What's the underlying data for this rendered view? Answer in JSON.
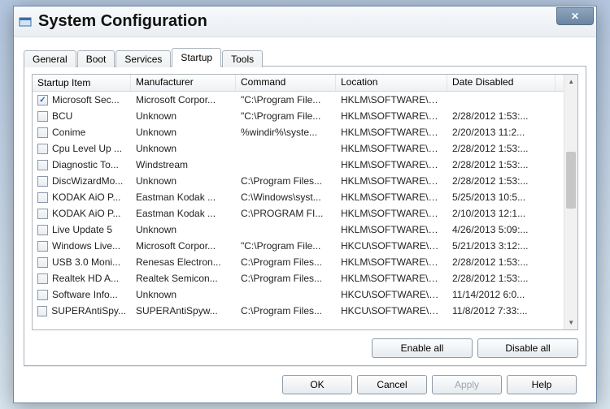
{
  "window": {
    "title": "System Configuration"
  },
  "tabs": [
    "General",
    "Boot",
    "Services",
    "Startup",
    "Tools"
  ],
  "active_tab": 3,
  "columns": [
    "Startup Item",
    "Manufacturer",
    "Command",
    "Location",
    "Date Disabled"
  ],
  "rows": [
    {
      "checked": true,
      "item": "Microsoft Sec...",
      "mfr": "Microsoft Corpor...",
      "cmd": "\"C:\\Program File...",
      "loc": "HKLM\\SOFTWARE\\Mi...",
      "date": ""
    },
    {
      "checked": false,
      "item": "BCU",
      "mfr": "Unknown",
      "cmd": "\"C:\\Program File...",
      "loc": "HKLM\\SOFTWARE\\W...",
      "date": "2/28/2012 1:53:..."
    },
    {
      "checked": false,
      "item": "Conime",
      "mfr": "Unknown",
      "cmd": "%windir%\\syste...",
      "loc": "HKLM\\SOFTWARE\\W...",
      "date": "2/20/2013 11:2..."
    },
    {
      "checked": false,
      "item": "Cpu Level Up ...",
      "mfr": "Unknown",
      "cmd": "",
      "loc": "HKLM\\SOFTWARE\\W...",
      "date": "2/28/2012 1:53:..."
    },
    {
      "checked": false,
      "item": "Diagnostic To...",
      "mfr": "Windstream",
      "cmd": "",
      "loc": "HKLM\\SOFTWARE\\W...",
      "date": "2/28/2012 1:53:..."
    },
    {
      "checked": false,
      "item": "DiscWizardMo...",
      "mfr": "Unknown",
      "cmd": "C:\\Program Files...",
      "loc": "HKLM\\SOFTWARE\\W...",
      "date": "2/28/2012 1:53:..."
    },
    {
      "checked": false,
      "item": "KODAK AiO P...",
      "mfr": "Eastman Kodak ...",
      "cmd": "C:\\Windows\\syst...",
      "loc": "HKLM\\SOFTWARE\\W...",
      "date": "5/25/2013 10:5..."
    },
    {
      "checked": false,
      "item": "KODAK AiO P...",
      "mfr": "Eastman Kodak ...",
      "cmd": "C:\\PROGRAM FI...",
      "loc": "HKLM\\SOFTWARE\\W...",
      "date": "2/10/2013 12:1..."
    },
    {
      "checked": false,
      "item": "Live Update 5",
      "mfr": "Unknown",
      "cmd": "",
      "loc": "HKLM\\SOFTWARE\\W...",
      "date": "4/26/2013 5:09:..."
    },
    {
      "checked": false,
      "item": "Windows Live...",
      "mfr": "Microsoft Corpor...",
      "cmd": "\"C:\\Program File...",
      "loc": "HKCU\\SOFTWARE\\Mi...",
      "date": "5/21/2013 3:12:..."
    },
    {
      "checked": false,
      "item": "USB 3.0 Moni...",
      "mfr": "Renesas Electron...",
      "cmd": "C:\\Program Files...",
      "loc": "HKLM\\SOFTWARE\\Mi...",
      "date": "2/28/2012 1:53:..."
    },
    {
      "checked": false,
      "item": "Realtek HD A...",
      "mfr": "Realtek Semicon...",
      "cmd": "C:\\Program Files...",
      "loc": "HKLM\\SOFTWARE\\Mi...",
      "date": "2/28/2012 1:53:..."
    },
    {
      "checked": false,
      "item": "Software Info...",
      "mfr": "Unknown",
      "cmd": "",
      "loc": "HKCU\\SOFTWARE\\Mi...",
      "date": "11/14/2012 6:0..."
    },
    {
      "checked": false,
      "item": "SUPERAntiSpy...",
      "mfr": "SUPERAntiSpyw...",
      "cmd": "C:\\Program Files...",
      "loc": "HKCU\\SOFTWARE\\Mi...",
      "date": "11/8/2012 7:33:..."
    }
  ],
  "panel_buttons": {
    "enable_all": "Enable all",
    "disable_all": "Disable all"
  },
  "dialog_buttons": {
    "ok": "OK",
    "cancel": "Cancel",
    "apply": "Apply",
    "help": "Help"
  }
}
